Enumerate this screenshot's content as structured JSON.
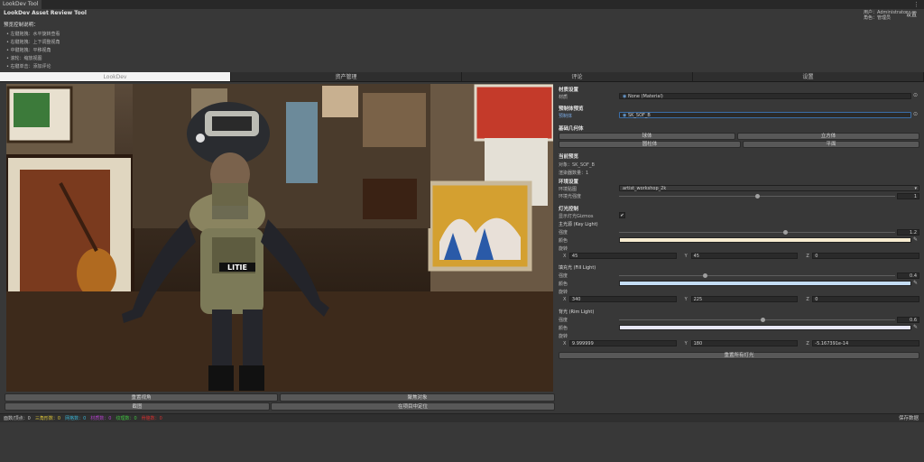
{
  "window": {
    "tab_label": "LookDev Tool"
  },
  "app": {
    "title": "LookDev Asset Review Tool",
    "user_line": "用户：Administrator",
    "role_line": "角色：管理员",
    "settings_label": "设置"
  },
  "instructions": {
    "title": "预览控制说明：",
    "items": [
      "• 左键拖拽：水平旋转查看",
      "• 右键拖拽：上下调整视角",
      "• 中键拖拽：平移视角",
      "• 滚轮：缩放视图",
      "• 右键单击：添加评论"
    ]
  },
  "tabs": [
    "LookDev",
    "资产管理",
    "评论",
    "设置"
  ],
  "viewport": {
    "patch_text": "LITIE"
  },
  "viewport_buttons": {
    "reset_view": "重置视角",
    "focus_object": "聚焦对象",
    "screenshot": "截图",
    "locate_in_project": "在项目中定位"
  },
  "status_stats": [
    {
      "text": "面数/顶点：0",
      "color": "#c9c9c9"
    },
    {
      "text": "三角形数：0",
      "color": "#d9c23a"
    },
    {
      "text": "网格数：0",
      "color": "#3ab0d0"
    },
    {
      "text": "材质数：0",
      "color": "#b040c8"
    },
    {
      "text": "纹理数：0",
      "color": "#40c040"
    },
    {
      "text": "骨骼数：0",
      "color": "#d03030"
    }
  ],
  "save_stats_label": "保存数据",
  "panel": {
    "material_section": "材质设置",
    "material_label": "材质",
    "material_value": "None (Material)",
    "prefab_section": "预制体预览",
    "prefab_label": "预制体",
    "prefab_value": "SK_SOF_B",
    "basic_geo_section": "基础几何体",
    "geo_buttons": [
      "球体",
      "立方体",
      "圆柱体",
      "平面"
    ],
    "current_preview_section": "当前预览",
    "object_line": "对象：SK_SOF_B",
    "render_count_line": "渲染器数量：1",
    "env_section": "环境设置",
    "env_map_label": "环境贴图",
    "env_map_value": "artist_workshop_2k",
    "env_intensity_label": "环境光强度",
    "env_intensity_value": "1",
    "env_intensity": 1.0,
    "light_section": "灯光控制",
    "gizmo_label": "显示灯光Gizmos",
    "gizmo_on": true,
    "key_light": {
      "title": "主光源 (Key Light)",
      "intensity_value": "1.2",
      "intensity_fraction": 0.6,
      "color": "#f7ecd0",
      "x": "45",
      "y": "45",
      "z": "0"
    },
    "fill_light": {
      "title": "填充光 (Fill Light)",
      "intensity_value": "0.4",
      "intensity_fraction": 0.31,
      "color": "#c4ddf5",
      "x": "340",
      "y": "225",
      "z": "0"
    },
    "rim_light": {
      "title": "背光 (Rim Light)",
      "intensity_value": "0.6",
      "intensity_fraction": 0.52,
      "color": "#e6e6f5",
      "x": "9.999999",
      "y": "180",
      "z": "-5.167391e-14"
    },
    "intensity_label": "强度",
    "color_label": "颜色",
    "rotation_label": "旋转",
    "reset_lights_label": "重置所有灯光",
    "axis_x": "X",
    "axis_y": "Y",
    "axis_z": "Z"
  }
}
